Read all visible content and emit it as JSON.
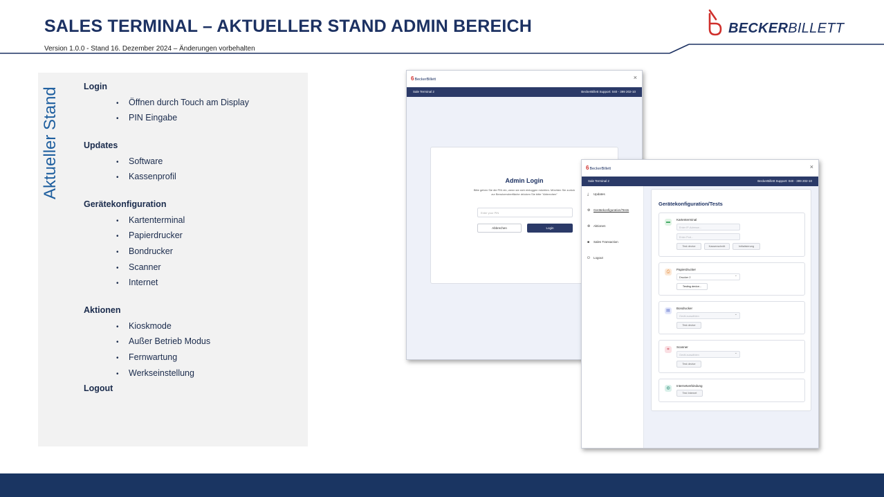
{
  "slide": {
    "title": "SALES TERMINAL – AKTUELLER STAND ADMIN BEREICH",
    "subtitle": "Version 1.0.0 - Stand 16. Dezember 2024 – Änderungen vorbehalten",
    "logo_bold": "BECKER",
    "logo_light": "BILLETT",
    "accent_color": "#1c3162",
    "logo_mark_color": "#d0302c"
  },
  "status": {
    "vertical_label": "Aktueller Stand",
    "sections": [
      {
        "heading": "Login",
        "items": [
          "Öffnen durch Touch am Display",
          "PIN Eingabe"
        ]
      },
      {
        "heading": "Updates",
        "items": [
          "Software",
          "Kassenprofil"
        ]
      },
      {
        "heading": "Gerätekonfiguration",
        "items": [
          "Kartenterminal",
          "Papierdrucker",
          "Bondrucker",
          "Scanner",
          "Internet"
        ]
      },
      {
        "heading": "Aktionen",
        "items": [
          "Kioskmode",
          "Außer Betrieb Modus",
          "Fernwartung",
          "Werkseinstellung"
        ]
      },
      {
        "heading": "Logout",
        "items": []
      }
    ]
  },
  "login_window": {
    "logo": "BeckerBillett",
    "close": "×",
    "nav_left": "Sale Terminal 2",
    "nav_right": "BeckerBillett Support: 040 - 399 202-10",
    "title": "Admin Login",
    "text": "Bitte geben Sie die PIN ein, wenn sie sich einloggen möchten. Möchten Sie zurück zur Benutzeroberfläche drücken Sie bitte \"Abbrechen\"",
    "pin_placeholder": "Enter your PIN",
    "cancel_label": "Abbrechen",
    "login_label": "Login"
  },
  "config_window": {
    "logo": "BeckerBillett",
    "close": "×",
    "nav_left": "Sale Terminal 2",
    "nav_right": "BeckerBillett Support: 040 - 399 202-10",
    "sidebar": [
      {
        "icon": "download-icon",
        "glyph": "⤓",
        "label": "Updates"
      },
      {
        "icon": "gear-icon",
        "glyph": "⚙",
        "label": "Gerätekonfiguration/Tests"
      },
      {
        "icon": "actions-icon",
        "glyph": "⊗",
        "label": "Aktionen"
      },
      {
        "icon": "cart-icon",
        "glyph": "■",
        "label": "Sales Transaction"
      },
      {
        "icon": "logout-icon",
        "glyph": "⏻",
        "label": "Logout"
      }
    ],
    "heading": "Gerätekonfiguration/Tests",
    "kartenterminal": {
      "title": "Kartenterminal",
      "ip_placeholder": "Enter IP-Adresse...",
      "port_placeholder": "Enter Port...",
      "btn_test": "Test device",
      "btn_kassenschnitt": "Kassenschnitt",
      "btn_init": "Initialisierung",
      "icon_color": "#3aa55d"
    },
    "papierdrucker": {
      "title": "Papierdrucker",
      "selected": "Drucker 2",
      "btn_test": "Testing device...",
      "icon_color": "#e58a3a"
    },
    "bondrucker": {
      "title": "Bondrucker",
      "placeholder": "Gerät auswählen",
      "btn_test": "Test device",
      "icon_color": "#5a6fc9"
    },
    "scanner": {
      "title": "Scanner",
      "placeholder": "Gerät auswählen",
      "btn_test": "Test device",
      "icon_color": "#d04a5a"
    },
    "internet": {
      "title": "Internetverbindung",
      "btn_test": "Test Internet",
      "icon_color": "#2f8f7a"
    }
  }
}
